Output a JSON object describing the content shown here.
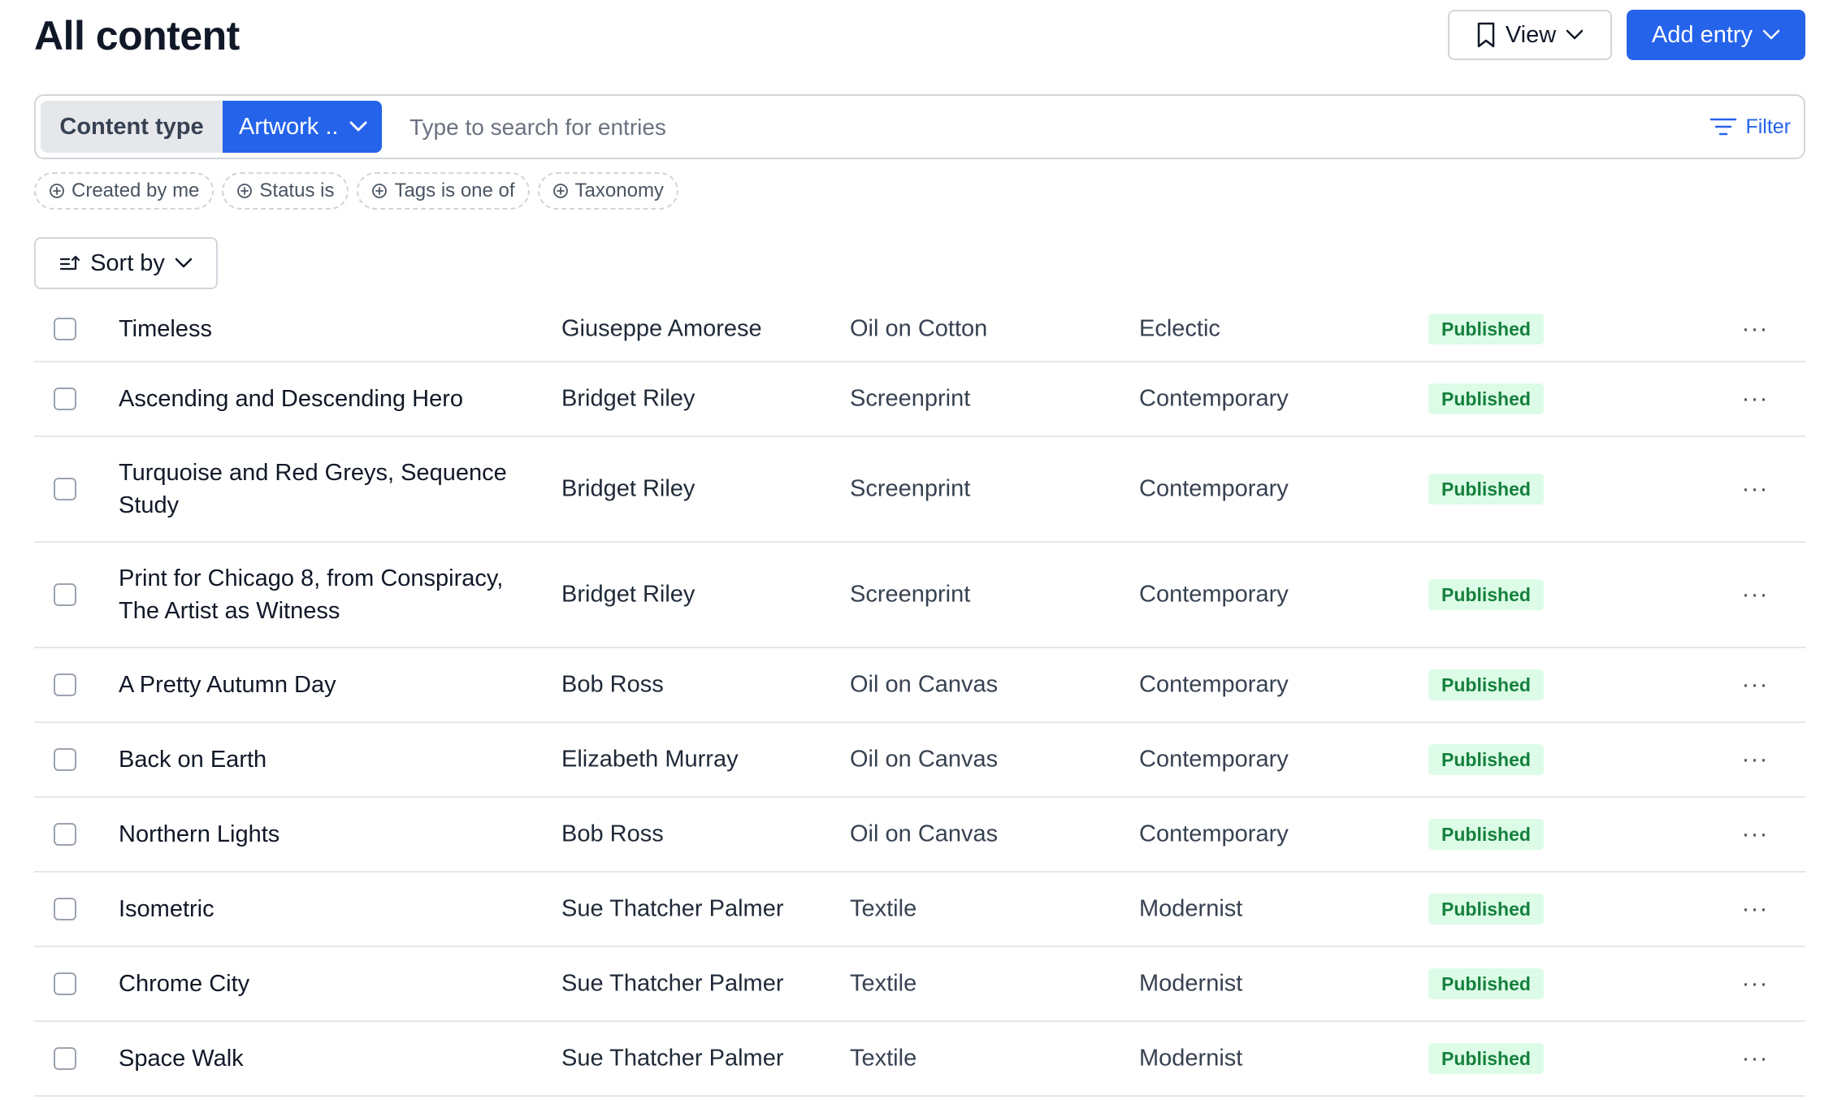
{
  "header": {
    "title": "All content",
    "view_label": "View",
    "add_label": "Add entry",
    "accent": "#2563eb"
  },
  "search": {
    "content_type_label": "Content type",
    "content_type_value": "Artwork ..",
    "placeholder": "Type to search for entries",
    "filter_label": "Filter"
  },
  "chips": [
    "Created by me",
    "Status is",
    "Tags is one of",
    "Taxonomy"
  ],
  "sort": {
    "label": "Sort by"
  },
  "rows": [
    {
      "title": "Timeless",
      "artist": "Giuseppe Amorese",
      "medium": "Oil on Cotton",
      "style": "Eclectic",
      "status": "Published"
    },
    {
      "title": "Ascending and Descending Hero",
      "artist": "Bridget Riley",
      "medium": "Screenprint",
      "style": "Contemporary",
      "status": "Published"
    },
    {
      "title": "Turquoise and Red Greys, Sequence Study",
      "artist": "Bridget Riley",
      "medium": "Screenprint",
      "style": "Contemporary",
      "status": "Published"
    },
    {
      "title": "Print for Chicago 8, from Conspiracy, The Artist as Witness",
      "artist": "Bridget Riley",
      "medium": "Screenprint",
      "style": "Contemporary",
      "status": "Published"
    },
    {
      "title": "A Pretty Autumn Day",
      "artist": "Bob Ross",
      "medium": "Oil on Canvas",
      "style": "Contemporary",
      "status": "Published"
    },
    {
      "title": "Back on Earth",
      "artist": "Elizabeth Murray",
      "medium": "Oil on Canvas",
      "style": "Contemporary",
      "status": "Published"
    },
    {
      "title": "Northern Lights",
      "artist": "Bob Ross",
      "medium": "Oil on Canvas",
      "style": "Contemporary",
      "status": "Published"
    },
    {
      "title": "Isometric",
      "artist": "Sue Thatcher Palmer",
      "medium": "Textile",
      "style": "Modernist",
      "status": "Published"
    },
    {
      "title": "Chrome City",
      "artist": "Sue Thatcher Palmer",
      "medium": "Textile",
      "style": "Modernist",
      "status": "Published"
    },
    {
      "title": "Space Walk",
      "artist": "Sue Thatcher Palmer",
      "medium": "Textile",
      "style": "Modernist",
      "status": "Published"
    }
  ],
  "icons": {
    "view": "bookmark-icon",
    "chevron": "chevron-down-icon",
    "filter": "filter-icon",
    "chip": "plus-circle-icon",
    "sort": "sort-icon",
    "row_menu": "more-horizontal-icon"
  },
  "status_colors": {
    "published_bg": "#dcfce7",
    "published_text": "#15803d"
  }
}
